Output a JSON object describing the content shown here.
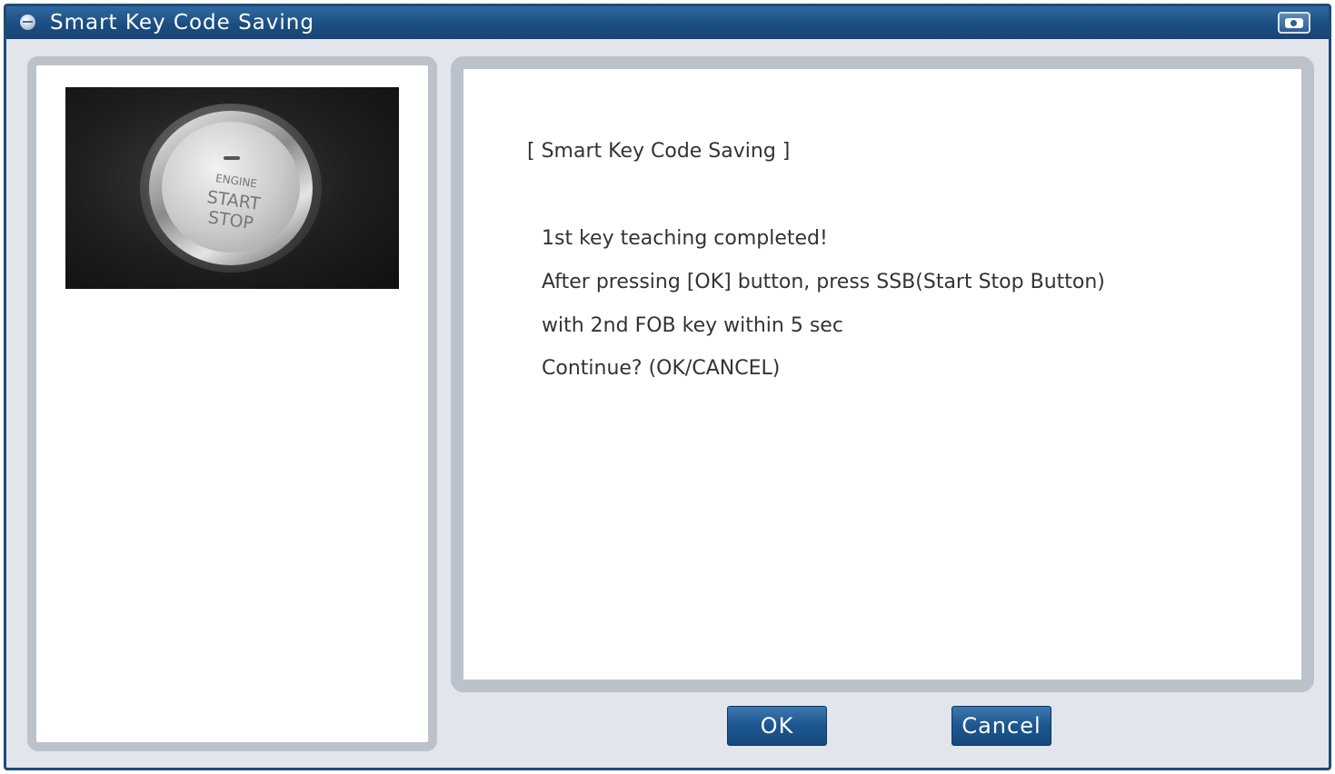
{
  "window": {
    "title": "Smart Key Code Saving"
  },
  "image": {
    "button_text_small": "ENGINE",
    "button_text_line1": "START",
    "button_text_line2": "STOP"
  },
  "message": {
    "title": "[ Smart Key Code Saving ]",
    "lines": [
      "1st key teaching completed!",
      "After pressing [OK] button, press SSB(Start Stop Button)",
      "with 2nd FOB key within 5 sec",
      "Continue? (OK/CANCEL)"
    ]
  },
  "buttons": {
    "ok_label": "OK",
    "cancel_label": "Cancel"
  },
  "icons": {
    "title_icon": "app-icon",
    "camera_button": "camera-icon"
  },
  "colors": {
    "titlebar": "#1c4e82",
    "button": "#1c568e",
    "panel_border": "#bcc2cc"
  }
}
